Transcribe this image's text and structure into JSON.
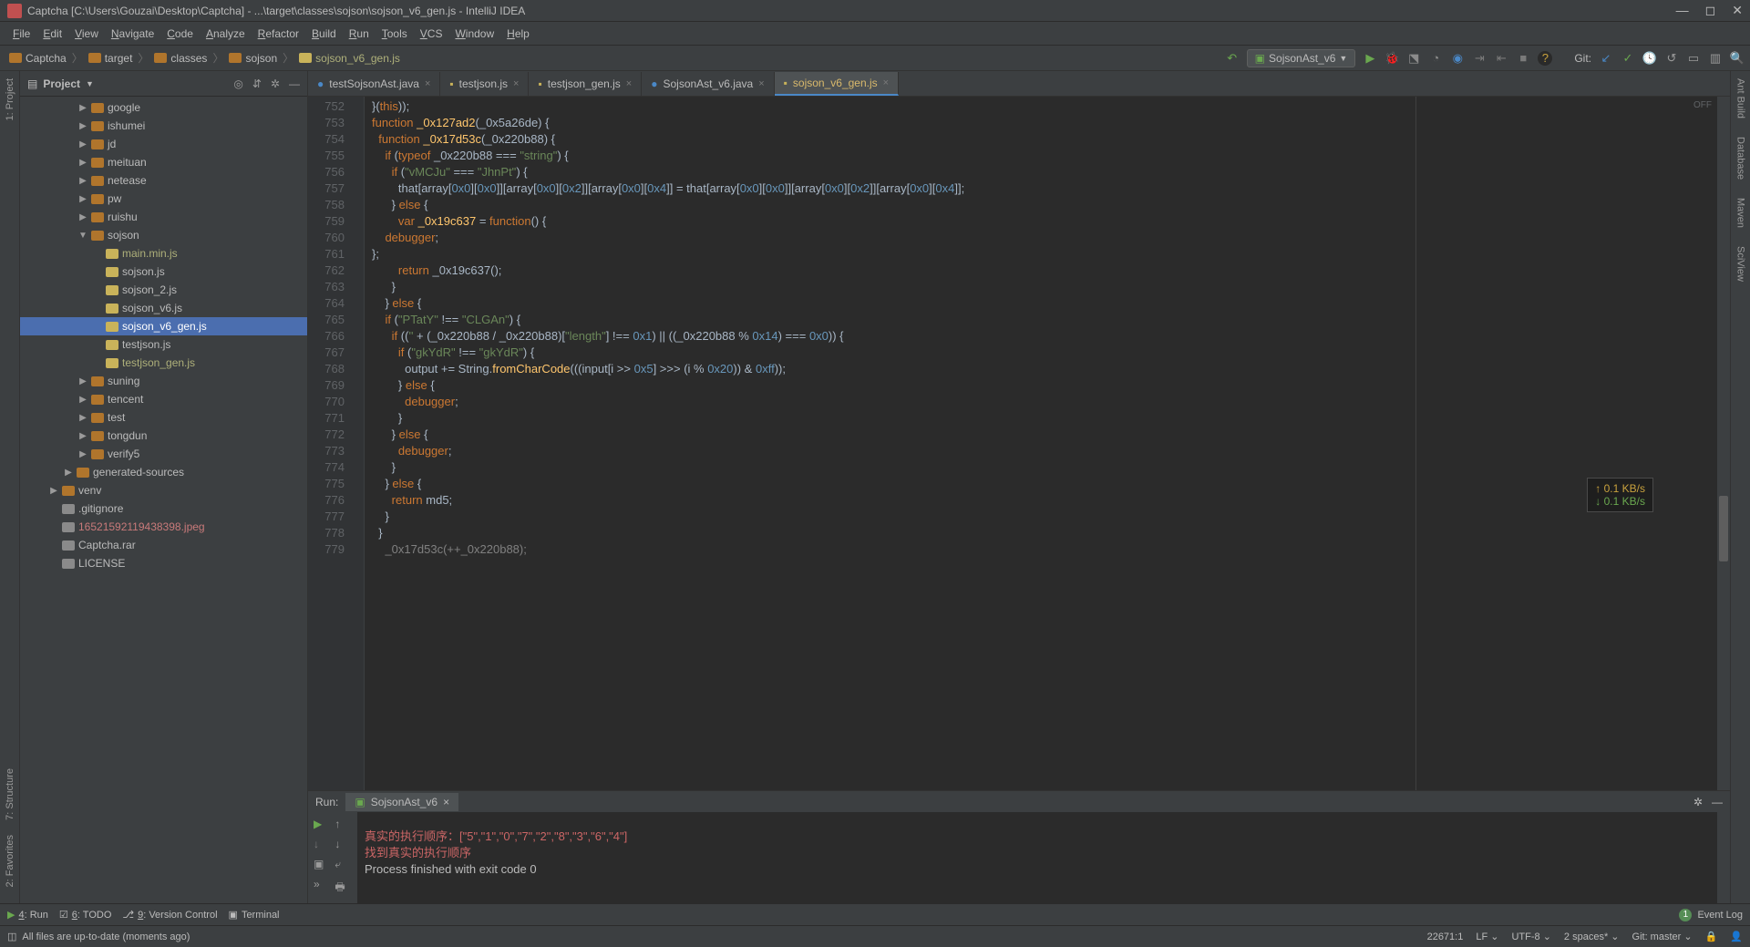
{
  "title": "Captcha [C:\\Users\\Gouzai\\Desktop\\Captcha] - ...\\target\\classes\\sojson\\sojson_v6_gen.js - IntelliJ IDEA",
  "menu": [
    "File",
    "Edit",
    "View",
    "Navigate",
    "Code",
    "Analyze",
    "Refactor",
    "Build",
    "Run",
    "Tools",
    "VCS",
    "Window",
    "Help"
  ],
  "breadcrumbs": [
    "Captcha",
    "target",
    "classes",
    "sojson",
    "sojson_v6_gen.js"
  ],
  "run_config": "SojsonAst_v6",
  "git_label": "Git:",
  "left_tools": [
    "1: Project"
  ],
  "right_tools": [
    "Ant Build",
    "Database",
    "Maven",
    "SciView"
  ],
  "project_panel": {
    "title": "Project"
  },
  "tree": [
    {
      "depth": 4,
      "arrow": "▶",
      "icon": "folder",
      "label": "google"
    },
    {
      "depth": 4,
      "arrow": "▶",
      "icon": "folder",
      "label": "ishumei"
    },
    {
      "depth": 4,
      "arrow": "▶",
      "icon": "folder",
      "label": "jd"
    },
    {
      "depth": 4,
      "arrow": "▶",
      "icon": "folder",
      "label": "meituan"
    },
    {
      "depth": 4,
      "arrow": "▶",
      "icon": "folder",
      "label": "netease"
    },
    {
      "depth": 4,
      "arrow": "▶",
      "icon": "folder",
      "label": "pw"
    },
    {
      "depth": 4,
      "arrow": "▶",
      "icon": "folder",
      "label": "ruishu"
    },
    {
      "depth": 4,
      "arrow": "▼",
      "icon": "folder",
      "label": "sojson"
    },
    {
      "depth": 5,
      "arrow": "",
      "icon": "jsfile",
      "label": "main.min.js",
      "cls": "genfile"
    },
    {
      "depth": 5,
      "arrow": "",
      "icon": "jsfile",
      "label": "sojson.js"
    },
    {
      "depth": 5,
      "arrow": "",
      "icon": "jsfile",
      "label": "sojson_2.js"
    },
    {
      "depth": 5,
      "arrow": "",
      "icon": "jsfile",
      "label": "sojson_v6.js"
    },
    {
      "depth": 5,
      "arrow": "",
      "icon": "jsfile",
      "label": "sojson_v6_gen.js",
      "selected": true
    },
    {
      "depth": 5,
      "arrow": "",
      "icon": "jsfile",
      "label": "testjson.js"
    },
    {
      "depth": 5,
      "arrow": "",
      "icon": "jsfile",
      "label": "testjson_gen.js",
      "cls": "genfile"
    },
    {
      "depth": 4,
      "arrow": "▶",
      "icon": "folder",
      "label": "suning"
    },
    {
      "depth": 4,
      "arrow": "▶",
      "icon": "folder",
      "label": "tencent"
    },
    {
      "depth": 4,
      "arrow": "▶",
      "icon": "folder",
      "label": "test"
    },
    {
      "depth": 4,
      "arrow": "▶",
      "icon": "folder",
      "label": "tongdun"
    },
    {
      "depth": 4,
      "arrow": "▶",
      "icon": "folder",
      "label": "verify5"
    },
    {
      "depth": 3,
      "arrow": "▶",
      "icon": "folder",
      "label": "generated-sources"
    },
    {
      "depth": 2,
      "arrow": "▶",
      "icon": "folder",
      "label": "venv"
    },
    {
      "depth": 2,
      "arrow": "",
      "icon": "file",
      "label": ".gitignore"
    },
    {
      "depth": 2,
      "arrow": "",
      "icon": "file",
      "label": "16521592119438398.jpeg",
      "cls": "redish"
    },
    {
      "depth": 2,
      "arrow": "",
      "icon": "file",
      "label": "Captcha.rar"
    },
    {
      "depth": 2,
      "arrow": "",
      "icon": "file",
      "label": "LICENSE"
    }
  ],
  "tabs": [
    {
      "label": "testSojsonAst.java",
      "icon": "java"
    },
    {
      "label": "testjson.js",
      "icon": "js"
    },
    {
      "label": "testjson_gen.js",
      "icon": "js"
    },
    {
      "label": "SojsonAst_v6.java",
      "icon": "java"
    },
    {
      "label": "sojson_v6_gen.js",
      "icon": "js",
      "active": true
    }
  ],
  "line_start": 752,
  "line_count": 28,
  "net": {
    "up": "↑ 0.1 KB/s",
    "down": "↓ 0.1 KB/s"
  },
  "editor_status": "OFF",
  "run": {
    "title": "Run:",
    "tab": "SojsonAst_v6",
    "lines": [
      {
        "text": "真实的执行顺序：[\"5\",\"1\",\"0\",\"7\",\"2\",\"8\",\"3\",\"6\",\"4\"]",
        "cls": "red"
      },
      {
        "text": "找到真实的执行顺序",
        "cls": "red"
      },
      {
        "text": ""
      },
      {
        "text": "Process finished with exit code 0"
      }
    ]
  },
  "bottom_tabs": [
    "4: Run",
    "6: TODO",
    "9: Version Control",
    "Terminal"
  ],
  "event_log": "Event Log",
  "status_msg": "All files are up-to-date (moments ago)",
  "status_right": {
    "pos": "22671:1",
    "le": "LF",
    "enc": "UTF-8",
    "indent": "2 spaces*",
    "branch": "Git: master"
  }
}
